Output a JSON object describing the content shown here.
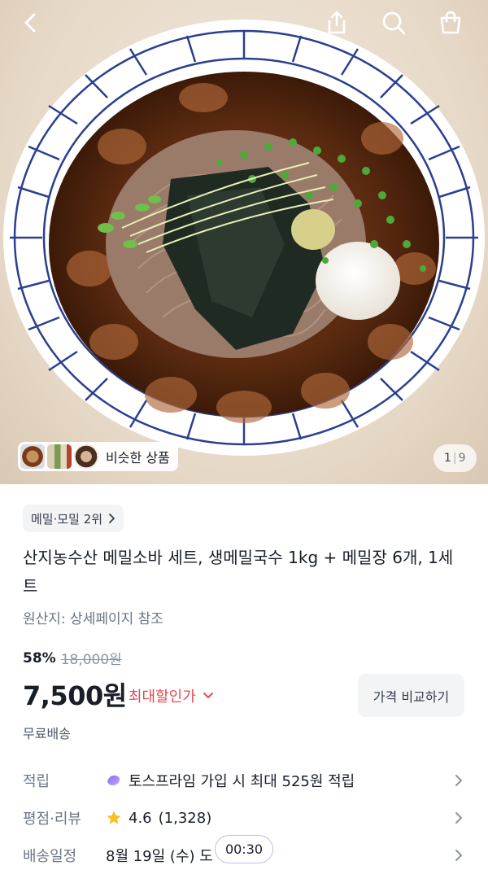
{
  "header": {
    "icons": [
      "back-icon",
      "share-icon",
      "search-icon",
      "cart-icon"
    ]
  },
  "gallery": {
    "similar_label": "비슷한 상품",
    "current": "1",
    "separator": "|",
    "total": "9"
  },
  "product": {
    "rank_label": "메밀·모밀 2위",
    "title": "산지농수산 메밀소바 세트, 생메밀국수 1kg + 메밀장 6개, 1세트",
    "origin": "원산지: 상세페이지 참조",
    "discount_rate": "58%",
    "original_price": "18,000원",
    "price": "7,500원",
    "max_discount_label": "최대할인가",
    "compare_button": "가격 비교하기",
    "shipping": "무료배송"
  },
  "info_rows": {
    "points": {
      "label": "적립",
      "value": "토스프라임 가입 시 최대 525원 적립"
    },
    "rating": {
      "label": "평점·리뷰",
      "score": "4.6",
      "count": "(1,328)"
    },
    "delivery": {
      "label": "배송일정",
      "value": "8월 19일 (수) 도"
    }
  },
  "timer": "00:30",
  "colors": {
    "accent_red": "#e5484d",
    "star": "#fbbf24",
    "chip_bg": "#f2f4f6",
    "text_primary": "#191f28",
    "text_secondary": "#6b7684"
  }
}
